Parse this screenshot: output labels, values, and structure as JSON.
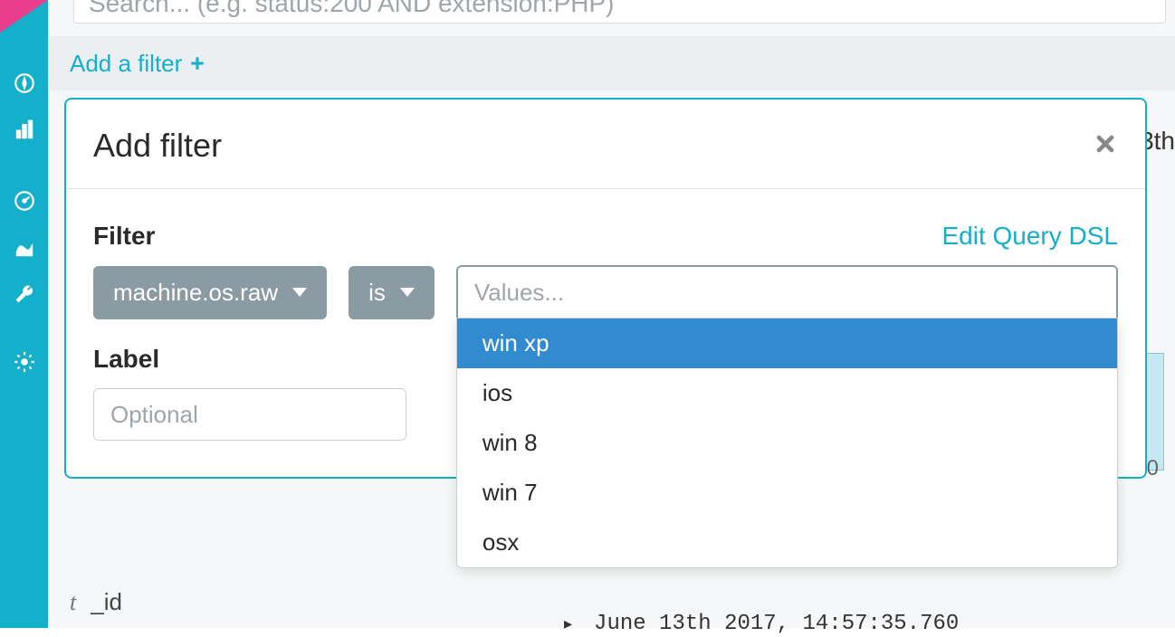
{
  "search": {
    "placeholder": "Search... (e.g. status:200 AND extension:PHP)"
  },
  "filterbar": {
    "add_filter_label": "Add a filter"
  },
  "modal": {
    "title": "Add filter",
    "filter_section_label": "Filter",
    "edit_dsl_label": "Edit Query DSL",
    "field_dropdown_value": "machine.os.raw",
    "operator_dropdown_value": "is",
    "values_placeholder": "Values...",
    "values_options": [
      {
        "label": "win xp",
        "highlighted": true
      },
      {
        "label": "ios",
        "highlighted": false
      },
      {
        "label": "win 8",
        "highlighted": false
      },
      {
        "label": "win 7",
        "highlighted": false
      },
      {
        "label": "osx",
        "highlighted": false
      }
    ],
    "label_section_label": "Label",
    "label_input_placeholder": "Optional"
  },
  "background": {
    "right_fragment": "3th",
    "axis_zero": "0",
    "field_type_glyph": "t",
    "field_name": "_id",
    "timestamp_caret": "▸",
    "timestamp": "June 13th 2017, 14:57:35.760"
  }
}
